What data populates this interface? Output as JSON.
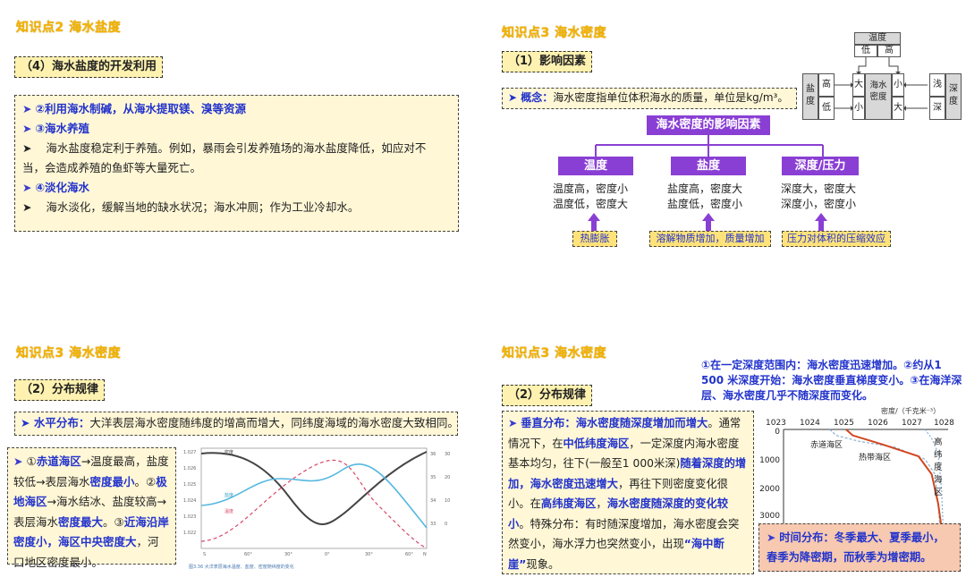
{
  "q1": {
    "title": "知识点2  海水盐度",
    "subtitle": "（4）海水盐度的开发利用",
    "b1_arrow": "➤",
    "b1": "②利用海水制碱，从海水提取镁、溴等资源",
    "b2_arrow": "➤",
    "b2": "③海水养殖",
    "b3_arrow": "➤",
    "b3_l1": "海水盐度稳定利于养殖。例如，暴雨会引发养殖场的海水盐度降低，如应对不",
    "b3_l2": "当，会造成养殖的鱼虾等大量死亡。",
    "b4_arrow": "➤",
    "b4": "④淡化海水",
    "b5_arrow": "➤",
    "b5": "海水淡化，缓解当地的缺水状况；海水冲厕；作为工业冷却水。"
  },
  "q2": {
    "title": "知识点3  海水密度",
    "subtitle": "（1）影响因素",
    "concept_label": "➤  概念：",
    "concept": "海水密度指单位体积海水的质量，单位是kg/m³。",
    "main_box": "海水密度的影响因素",
    "factors": [
      {
        "name": "温度",
        "l1": "温度高，密度小",
        "l2": "温度低，密度大",
        "note": "热膨胀"
      },
      {
        "name": "盐度",
        "l1": "盐度高，密度大",
        "l2": "盐度低，密度小",
        "note": "溶解物质增加，质量增加"
      },
      {
        "name": "深度/压力",
        "l1": "深度大，密度大",
        "l2": "深度小，密度小",
        "note": "压力对体积的压缩效应"
      }
    ],
    "diagram": {
      "temp": "温度",
      "low": "低",
      "high": "高",
      "salinity": "盐度",
      "s_high": "高",
      "s_low": "低",
      "big": "大",
      "small": "小",
      "density": "海水密度",
      "d_small": "小",
      "d_big": "大",
      "shallow": "浅",
      "deep": "深",
      "depth": "深度"
    }
  },
  "q3": {
    "title": "知识点3  海水密度",
    "subtitle": "（2）分布规律",
    "h_label": "➤  水平分布：",
    "h_text": "大洋表层海水密度随纬度的增高而增大，同纬度海域的海水密度大致相同。",
    "p_arrow": "➤",
    "p1": "①",
    "p2": "赤道海区",
    "p3": "→温度最高，盐度较低→表层海水",
    "p4": "密度最小",
    "p5": "。②",
    "p6": "极地海区",
    "p7": "→海水结冰、盐度较高→表层海水",
    "p8": "密度最大",
    "p9": "。③",
    "p10": "近海沿岸密度小，海区中央密度大",
    "p11": "，河口地区密度最小。",
    "fig_caption": "图3.36  大洋表层海水温度、盐度、密度随纬度的变化",
    "fig_lines": [
      "密度",
      "盐度",
      "温度"
    ]
  },
  "q4": {
    "title": "知识点3  海水密度",
    "subtitle": "（2）分布规律",
    "note": "①在一定深度范围内：海水密度迅速增加。②约从1 500 米深度开始：海水密度垂直梯度变小。③在海洋深层、海水密度几乎不随深度而变化。",
    "v_arrow": "➤",
    "v_label": "垂直分布：",
    "v1": "海水密度随深度增加而增大",
    "v2": "。通常情况下，在",
    "v3": "中低纬度海区",
    "v4": "，一定深度内海水密度基本均匀，往下(一般至1 000米深)",
    "v5": "随着深度的增加，海水密度迅速增大",
    "v6": "，再往下则密度变化很小。在",
    "v7": "高纬度海区",
    "v8": "，",
    "v9": "海水密度随深度的变化较小",
    "v10": "。特殊分布：有时随深度增加，海水密度会突然变小，海水浮力也突然变小，出现",
    "v11": "“海中断崖”",
    "v12": "现象。",
    "t_arrow": "➤",
    "t_label": "时间分布：",
    "t_text": "冬季最大、夏季最小，春季为降密期，而秋季为增密期。",
    "chart": {
      "ylabel": "密度/（千克米⁻³）",
      "xticks": [
        "1023",
        "1024",
        "1025",
        "1026",
        "1027",
        "1028"
      ],
      "yticks": [
        "0",
        "1000",
        "2000",
        "3000"
      ],
      "label_eq": "赤道海区",
      "label_trop": "热带海区",
      "label_high": "高纬度海区"
    }
  },
  "chart_data": {
    "type": "line",
    "title": "",
    "xlabel": "密度/（千克米⁻³）",
    "ylabel": "",
    "xlim": [
      1023,
      1028
    ],
    "ylim": [
      0,
      3000
    ],
    "series": [
      {
        "name": "赤道海区",
        "x": [
          1024.4,
          1024.6,
          1025.3,
          1026.4,
          1027.3,
          1027.6,
          1027.7,
          1027.75
        ],
        "y": [
          0,
          200,
          400,
          600,
          1000,
          1500,
          2500,
          3300
        ]
      },
      {
        "name": "热带海区",
        "x": [
          1024.9,
          1025.1,
          1026.0,
          1027.1,
          1027.5,
          1027.7,
          1027.8
        ],
        "y": [
          0,
          200,
          500,
          900,
          1500,
          2500,
          3300
        ]
      },
      {
        "name": "高纬度海区",
        "x": [
          1027.3,
          1027.5,
          1027.7,
          1027.8,
          1027.85
        ],
        "y": [
          0,
          300,
          800,
          2000,
          3300
        ]
      }
    ]
  }
}
